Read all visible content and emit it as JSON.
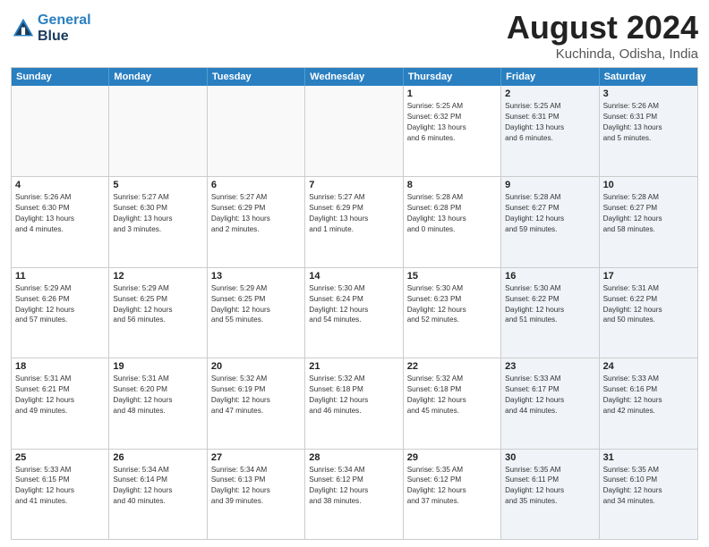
{
  "header": {
    "logo_line1": "General",
    "logo_line2": "Blue",
    "month_title": "August 2024",
    "location": "Kuchinda, Odisha, India"
  },
  "weekdays": [
    "Sunday",
    "Monday",
    "Tuesday",
    "Wednesday",
    "Thursday",
    "Friday",
    "Saturday"
  ],
  "rows": [
    [
      {
        "day": "",
        "info": "",
        "empty": true
      },
      {
        "day": "",
        "info": "",
        "empty": true
      },
      {
        "day": "",
        "info": "",
        "empty": true
      },
      {
        "day": "",
        "info": "",
        "empty": true
      },
      {
        "day": "1",
        "info": "Sunrise: 5:25 AM\nSunset: 6:32 PM\nDaylight: 13 hours\nand 6 minutes."
      },
      {
        "day": "2",
        "info": "Sunrise: 5:25 AM\nSunset: 6:31 PM\nDaylight: 13 hours\nand 6 minutes."
      },
      {
        "day": "3",
        "info": "Sunrise: 5:26 AM\nSunset: 6:31 PM\nDaylight: 13 hours\nand 5 minutes."
      }
    ],
    [
      {
        "day": "4",
        "info": "Sunrise: 5:26 AM\nSunset: 6:30 PM\nDaylight: 13 hours\nand 4 minutes."
      },
      {
        "day": "5",
        "info": "Sunrise: 5:27 AM\nSunset: 6:30 PM\nDaylight: 13 hours\nand 3 minutes."
      },
      {
        "day": "6",
        "info": "Sunrise: 5:27 AM\nSunset: 6:29 PM\nDaylight: 13 hours\nand 2 minutes."
      },
      {
        "day": "7",
        "info": "Sunrise: 5:27 AM\nSunset: 6:29 PM\nDaylight: 13 hours\nand 1 minute."
      },
      {
        "day": "8",
        "info": "Sunrise: 5:28 AM\nSunset: 6:28 PM\nDaylight: 13 hours\nand 0 minutes."
      },
      {
        "day": "9",
        "info": "Sunrise: 5:28 AM\nSunset: 6:27 PM\nDaylight: 12 hours\nand 59 minutes."
      },
      {
        "day": "10",
        "info": "Sunrise: 5:28 AM\nSunset: 6:27 PM\nDaylight: 12 hours\nand 58 minutes."
      }
    ],
    [
      {
        "day": "11",
        "info": "Sunrise: 5:29 AM\nSunset: 6:26 PM\nDaylight: 12 hours\nand 57 minutes."
      },
      {
        "day": "12",
        "info": "Sunrise: 5:29 AM\nSunset: 6:25 PM\nDaylight: 12 hours\nand 56 minutes."
      },
      {
        "day": "13",
        "info": "Sunrise: 5:29 AM\nSunset: 6:25 PM\nDaylight: 12 hours\nand 55 minutes."
      },
      {
        "day": "14",
        "info": "Sunrise: 5:30 AM\nSunset: 6:24 PM\nDaylight: 12 hours\nand 54 minutes."
      },
      {
        "day": "15",
        "info": "Sunrise: 5:30 AM\nSunset: 6:23 PM\nDaylight: 12 hours\nand 52 minutes."
      },
      {
        "day": "16",
        "info": "Sunrise: 5:30 AM\nSunset: 6:22 PM\nDaylight: 12 hours\nand 51 minutes."
      },
      {
        "day": "17",
        "info": "Sunrise: 5:31 AM\nSunset: 6:22 PM\nDaylight: 12 hours\nand 50 minutes."
      }
    ],
    [
      {
        "day": "18",
        "info": "Sunrise: 5:31 AM\nSunset: 6:21 PM\nDaylight: 12 hours\nand 49 minutes."
      },
      {
        "day": "19",
        "info": "Sunrise: 5:31 AM\nSunset: 6:20 PM\nDaylight: 12 hours\nand 48 minutes."
      },
      {
        "day": "20",
        "info": "Sunrise: 5:32 AM\nSunset: 6:19 PM\nDaylight: 12 hours\nand 47 minutes."
      },
      {
        "day": "21",
        "info": "Sunrise: 5:32 AM\nSunset: 6:18 PM\nDaylight: 12 hours\nand 46 minutes."
      },
      {
        "day": "22",
        "info": "Sunrise: 5:32 AM\nSunset: 6:18 PM\nDaylight: 12 hours\nand 45 minutes."
      },
      {
        "day": "23",
        "info": "Sunrise: 5:33 AM\nSunset: 6:17 PM\nDaylight: 12 hours\nand 44 minutes."
      },
      {
        "day": "24",
        "info": "Sunrise: 5:33 AM\nSunset: 6:16 PM\nDaylight: 12 hours\nand 42 minutes."
      }
    ],
    [
      {
        "day": "25",
        "info": "Sunrise: 5:33 AM\nSunset: 6:15 PM\nDaylight: 12 hours\nand 41 minutes."
      },
      {
        "day": "26",
        "info": "Sunrise: 5:34 AM\nSunset: 6:14 PM\nDaylight: 12 hours\nand 40 minutes."
      },
      {
        "day": "27",
        "info": "Sunrise: 5:34 AM\nSunset: 6:13 PM\nDaylight: 12 hours\nand 39 minutes."
      },
      {
        "day": "28",
        "info": "Sunrise: 5:34 AM\nSunset: 6:12 PM\nDaylight: 12 hours\nand 38 minutes."
      },
      {
        "day": "29",
        "info": "Sunrise: 5:35 AM\nSunset: 6:12 PM\nDaylight: 12 hours\nand 37 minutes."
      },
      {
        "day": "30",
        "info": "Sunrise: 5:35 AM\nSunset: 6:11 PM\nDaylight: 12 hours\nand 35 minutes."
      },
      {
        "day": "31",
        "info": "Sunrise: 5:35 AM\nSunset: 6:10 PM\nDaylight: 12 hours\nand 34 minutes."
      }
    ]
  ]
}
